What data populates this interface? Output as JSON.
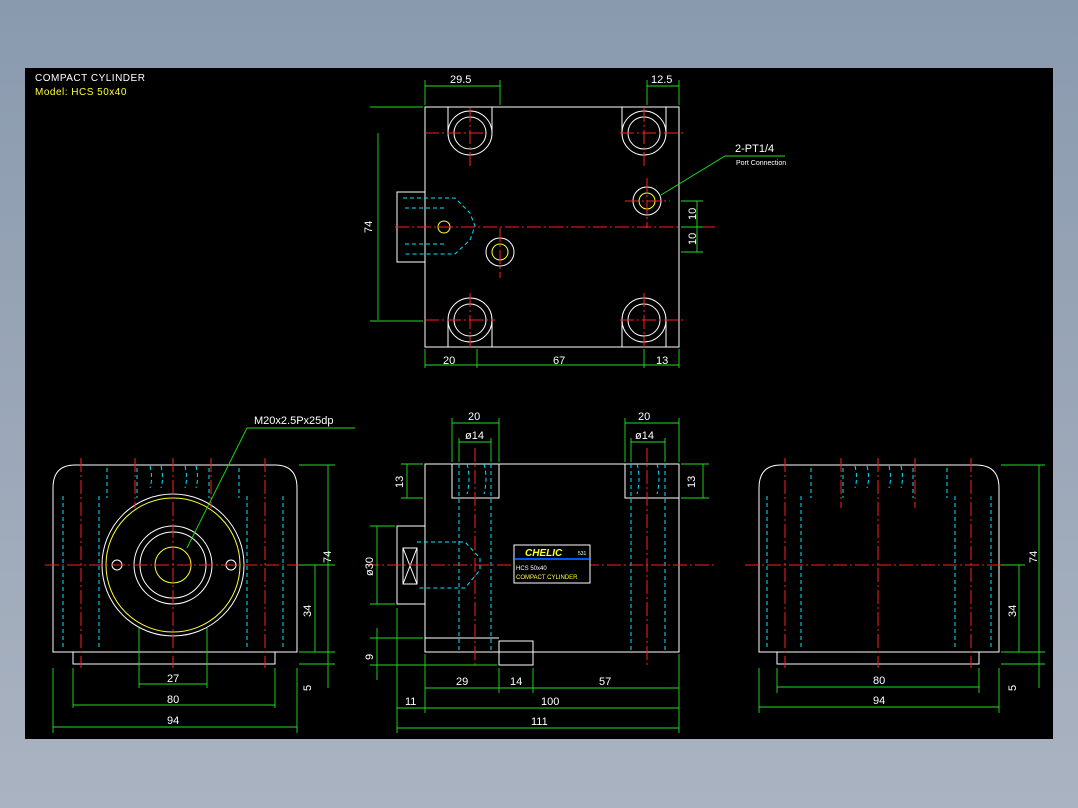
{
  "title": "COMPACT CYLINDER",
  "model": "Model: HCS 50x40",
  "nameplate": {
    "brand": "CHELIC",
    "badge": "531",
    "line1": "HCS 50x40",
    "line2": "COMPACT CYLINDER"
  },
  "callouts": {
    "port_label": "2-PT1/4",
    "port_sub": "Port Connection",
    "thread": "M20x2.5Px25dp"
  },
  "dimensions": {
    "top": {
      "w1": "29.5",
      "w2": "12.5",
      "h": "74",
      "p1": "10",
      "p2": "10",
      "b1": "20",
      "b2": "67",
      "b3": "13"
    },
    "left": {
      "h": "74",
      "h2": "34",
      "h3": "5",
      "w1": "27",
      "w2": "80",
      "w3": "94"
    },
    "front": {
      "t1": "20",
      "t2": "20",
      "d1": "ø14",
      "d2": "ø14",
      "s1": "13",
      "s2": "13",
      "rod": "ø30",
      "r9": "9",
      "b1": "29",
      "b2": "14",
      "b3": "57",
      "b4": "11",
      "b5": "100",
      "b6": "111"
    },
    "right": {
      "h": "74",
      "h2": "34",
      "h3": "5",
      "w1": "80",
      "w2": "94"
    }
  },
  "colors": {
    "background": "#000000",
    "outline": "#ffffff",
    "hidden": "#00e5ff",
    "center": "#ff2020",
    "dimension": "#22dd22",
    "text_accent": "#ffff33"
  }
}
